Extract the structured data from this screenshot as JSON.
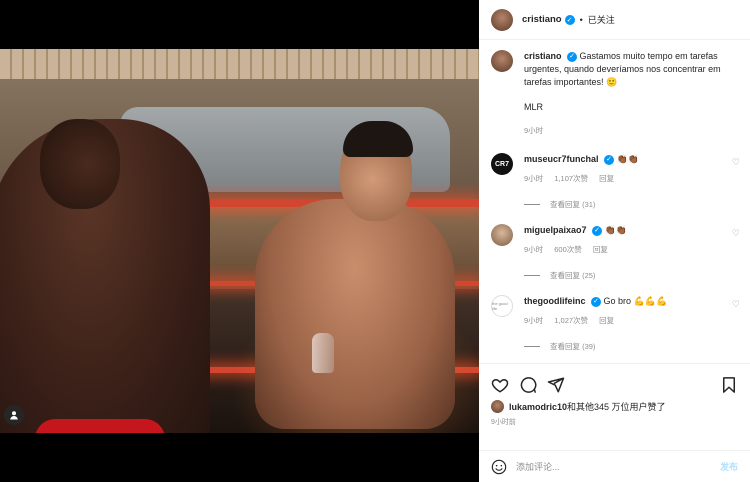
{
  "post": {
    "username": "cristiano",
    "follow_label": "已关注",
    "caption": "Gastamos muito tempo em tarefas urgentes, quando deveríamos nos concentrar em tarefas importantes! 🙂",
    "caption_sign": "MLR",
    "caption_time": "9小时"
  },
  "comments": [
    {
      "user": "museucr7funchal",
      "text": "👏🏾👏🏾",
      "time": "9小时",
      "likes": "1,107次赞",
      "reply": "回复",
      "view_replies": "查看回复 (31)",
      "avatar_text": "CR7"
    },
    {
      "user": "miguelpaixao7",
      "text": "👏🏾👏🏾",
      "time": "9小时",
      "likes": "600次赞",
      "reply": "回复",
      "view_replies": "查看回复 (25)",
      "avatar_text": ""
    },
    {
      "user": "thegoodlifeinc",
      "text": "Go bro 💪💪💪",
      "time": "9小时",
      "likes": "1,027次赞",
      "reply": "回复",
      "view_replies": "查看回复 (39)",
      "avatar_text": "the good life"
    }
  ],
  "likes_summary": {
    "user": "lukamodric10",
    "rest": "和其他345 万位用户赞了"
  },
  "post_time": "9小时前",
  "add_comment": {
    "placeholder": "添加评论...",
    "post_label": "发布"
  },
  "icons": {
    "verified": "verified-badge-icon",
    "heart": "heart-icon",
    "comment": "comment-icon",
    "share": "share-icon",
    "save": "bookmark-icon",
    "emoji": "emoji-icon",
    "tag": "user-tag-icon"
  },
  "colors": {
    "verified": "#0095f6",
    "post_disabled": "#b2dffc",
    "meta": "#8e8e8e"
  }
}
